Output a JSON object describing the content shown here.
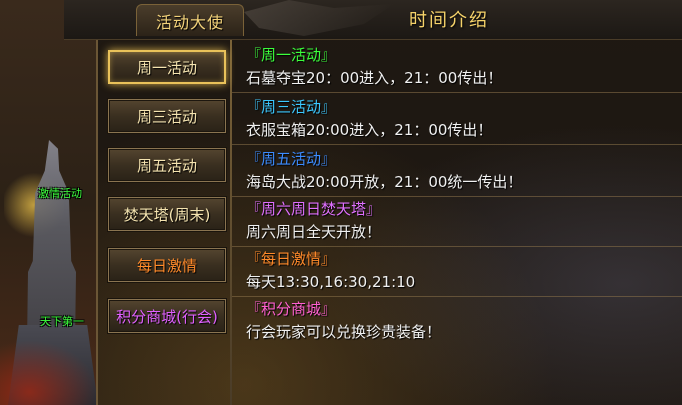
{
  "header": {
    "tab_label": "活动大使",
    "title": "时间介绍"
  },
  "npc_labels": [
    "激情活动",
    "天下第一"
  ],
  "menu": {
    "items": [
      {
        "label": "周一活动",
        "color": "#f5e4b0",
        "selected": true
      },
      {
        "label": "周三活动",
        "color": "#f5e4b0",
        "selected": false
      },
      {
        "label": "周五活动",
        "color": "#f5e4b0",
        "selected": false
      },
      {
        "label": "焚天塔(周末)",
        "color": "#f5e4b0",
        "selected": false
      },
      {
        "label": "每日激情",
        "color": "#ff8a2a",
        "selected": false
      },
      {
        "label": "积分商城(行会)",
        "color": "#e060ff",
        "selected": false
      }
    ]
  },
  "events": [
    {
      "heading": "『周一活动』",
      "heading_color": "#3cff3c",
      "description": "石墓夺宝20：00进入，21：00传出！"
    },
    {
      "heading": "『周三活动』",
      "heading_color": "#3cc8ff",
      "description": "衣服宝箱20:00进入，21：00传出！"
    },
    {
      "heading": "『周五活动』",
      "heading_color": "#3c8cff",
      "description": "海岛大战20:00开放，21：00统一传出！"
    },
    {
      "heading": "『周六周日焚天塔』",
      "heading_color": "#e070ff",
      "description": "周六周日全天开放！"
    },
    {
      "heading": "『每日激情』",
      "heading_color": "#ff8a2a",
      "description": "每天13:30,16:30,21:10"
    },
    {
      "heading": "『积分商城』",
      "heading_color": "#ff60d0",
      "description": "行会玩家可以兑换珍贵装备！"
    }
  ]
}
